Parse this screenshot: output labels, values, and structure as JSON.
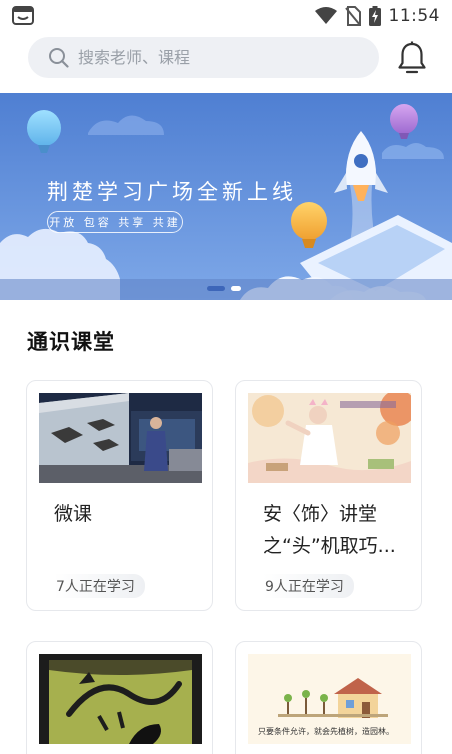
{
  "status_bar": {
    "time": "11:54",
    "icons": [
      "app-notification-icon",
      "wifi-icon",
      "no-sim-icon",
      "battery-charging-icon"
    ]
  },
  "search": {
    "placeholder": "搜索老师、课程",
    "icon": "search-icon"
  },
  "header": {
    "notification_icon": "bell-icon"
  },
  "banner": {
    "title": "荆楚学习广场全新上线",
    "tagline": "开放 包容 共享 共建",
    "slide_count": 2,
    "active_slide": 1
  },
  "section": {
    "title": "通识课堂"
  },
  "courses": [
    {
      "title": "微课",
      "learners": "7人正在学习"
    },
    {
      "title": "安〈饰〉讲堂之“头”机取巧...",
      "learners": "9人正在学习"
    },
    {
      "title": "",
      "learners": ""
    },
    {
      "title": "",
      "learners": "",
      "thumb_caption": "只要条件允许，就会先植树，造园林。"
    }
  ],
  "colors": {
    "banner_sky": "#5b8ad6",
    "dot_active": "#3d66b9",
    "search_bg": "#eef0f4"
  }
}
